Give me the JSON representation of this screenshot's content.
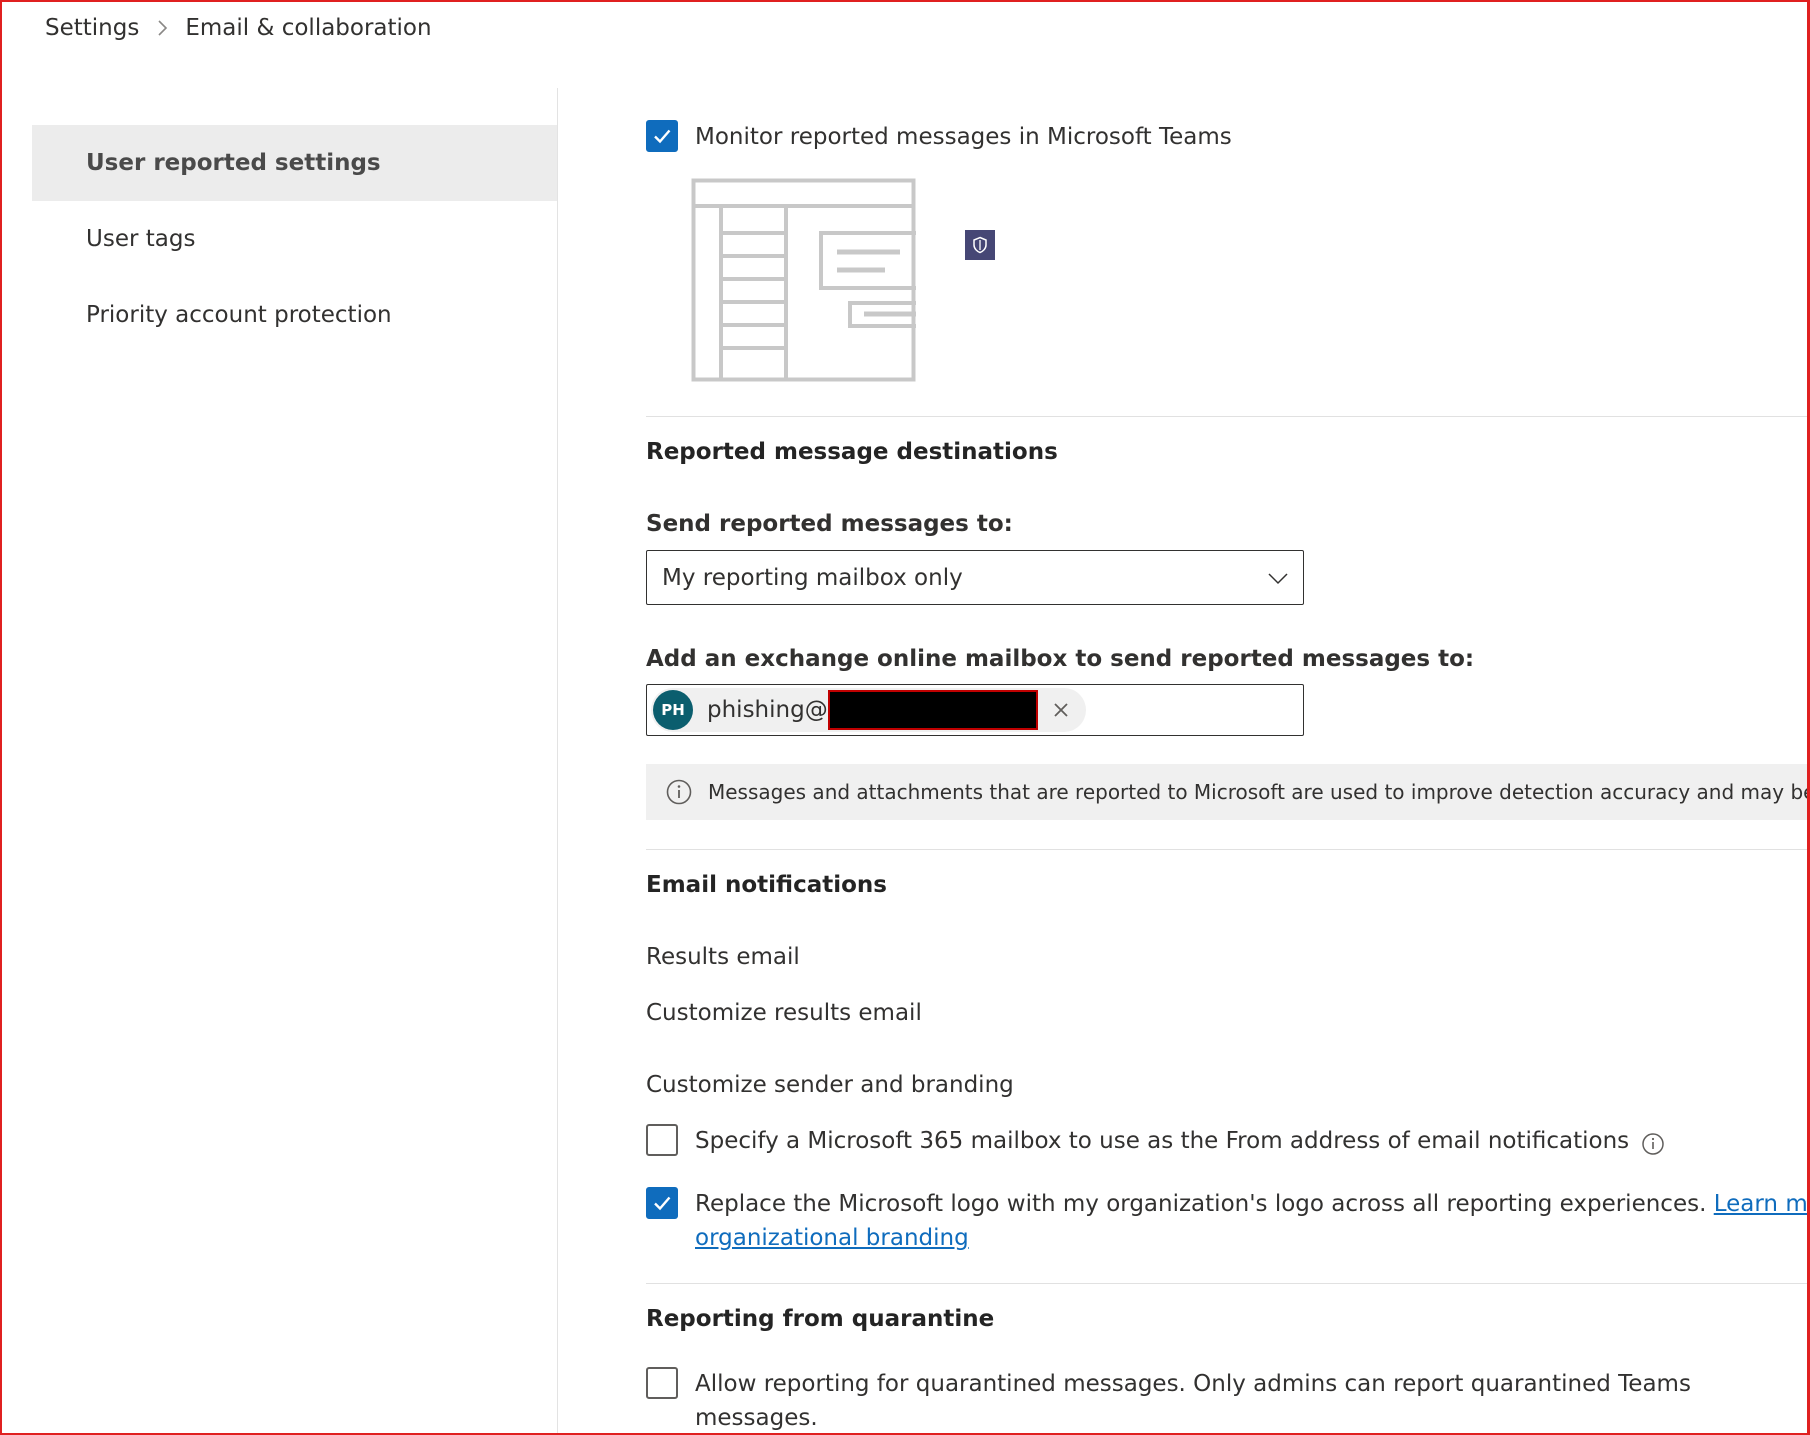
{
  "breadcrumb": {
    "items": [
      "Settings",
      "Email & collaboration"
    ]
  },
  "nav": {
    "items": [
      {
        "label": "User reported settings",
        "active": true
      },
      {
        "label": "User tags",
        "active": false
      },
      {
        "label": "Priority account protection",
        "active": false
      }
    ]
  },
  "teams": {
    "monitor_label": "Monitor reported messages in Microsoft Teams",
    "monitor_checked": true,
    "illustration_icon": "teams-shield-illustration"
  },
  "destinations": {
    "title": "Reported message destinations",
    "send_label": "Send reported messages to:",
    "send_value": "My reporting mailbox only",
    "mailbox_label": "Add an exchange online mailbox to send reported messages to:",
    "persona_initials": "PH",
    "persona_name": "phishing@",
    "info_text": "Messages and attachments that are reported to Microsoft are used to improve detection accuracy and may be read by"
  },
  "notifications": {
    "title": "Email notifications",
    "results_email_label": "Results email",
    "customize_results_link": "Customize results email",
    "branding_label": "Customize sender and branding",
    "specify_mailbox_label": "Specify a Microsoft 365 mailbox to use as the From address of email notifications",
    "specify_mailbox_checked": false,
    "replace_logo_label": "Replace the Microsoft logo with my organization's logo across all reporting experiences.",
    "replace_logo_link_1": "Learn more ab",
    "replace_logo_link_2": "organizational branding",
    "replace_logo_checked": true
  },
  "quarantine": {
    "title": "Reporting from quarantine",
    "allow_label": "Allow reporting for quarantined messages. Only admins can report quarantined Teams messages.",
    "allow_checked": false
  },
  "colors": {
    "accent": "#0f6cbd",
    "avatar": "#0b5e6e",
    "frame": "#e02020",
    "nav_active_bg": "#ececec",
    "infobar_bg": "#f0f0f0"
  }
}
